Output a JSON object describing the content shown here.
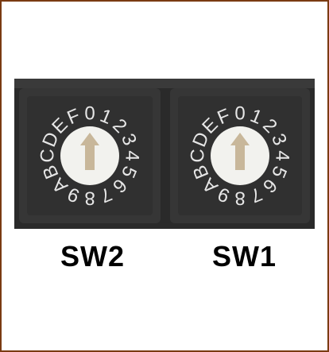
{
  "switches": [
    {
      "name": "SW2",
      "dial_positions": [
        "0",
        "1",
        "2",
        "3",
        "4",
        "5",
        "6",
        "7",
        "8",
        "9",
        "A",
        "B",
        "C",
        "D",
        "E",
        "F"
      ],
      "pointer": "0"
    },
    {
      "name": "SW1",
      "dial_positions": [
        "0",
        "1",
        "2",
        "3",
        "4",
        "5",
        "6",
        "7",
        "8",
        "9",
        "A",
        "B",
        "C",
        "D",
        "E",
        "F"
      ],
      "pointer": "0"
    }
  ],
  "colors": {
    "frame_border": "#7a3a12",
    "switch_body": "#2e2e2e",
    "knob": "#f2f2ee",
    "pointer": "#c8b79a",
    "dial_text": "#e6e6e6"
  }
}
